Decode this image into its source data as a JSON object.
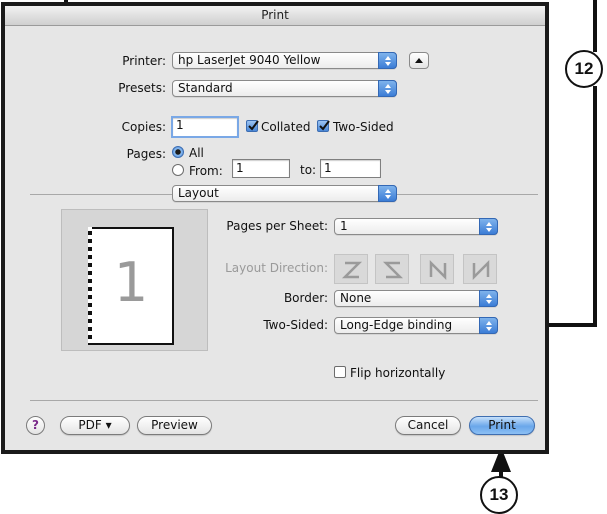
{
  "window": {
    "title": "Print"
  },
  "printer": {
    "label": "Printer:",
    "value": "hp LaserJet 9040 Yellow"
  },
  "presets": {
    "label": "Presets:",
    "value": "Standard"
  },
  "copies": {
    "label": "Copies:",
    "value": "1",
    "collated_label": "Collated",
    "collated": true,
    "two_sided_label": "Two-Sided",
    "two_sided": true
  },
  "pages": {
    "label": "Pages:",
    "all_label": "All",
    "from_label": "From:",
    "from_value": "1",
    "to_label": "to:",
    "to_value": "1",
    "selected": "All"
  },
  "section_popup": {
    "value": "Layout"
  },
  "layout": {
    "preview_page_number": "1",
    "pages_per_sheet": {
      "label": "Pages per Sheet:",
      "value": "1"
    },
    "layout_direction": {
      "label": "Layout Direction:",
      "buttons": [
        "z-icon",
        "reverse-z-icon",
        "n-icon",
        "reverse-n-icon"
      ]
    },
    "border": {
      "label": "Border:",
      "value": "None"
    },
    "two_sided": {
      "label": "Two-Sided:",
      "value": "Long-Edge binding"
    },
    "flip_horizontally": {
      "label": "Flip horizontally",
      "checked": false
    }
  },
  "footer": {
    "help": "?",
    "pdf_label": "PDF ▾",
    "preview_label": "Preview",
    "cancel_label": "Cancel",
    "print_label": "Print"
  },
  "callouts": {
    "twelve": "12",
    "thirteen": "13"
  },
  "colors": {
    "accent": "#4a88d8",
    "frame": "#1a1a1a",
    "dialog_bg": "#e6e6e6"
  }
}
